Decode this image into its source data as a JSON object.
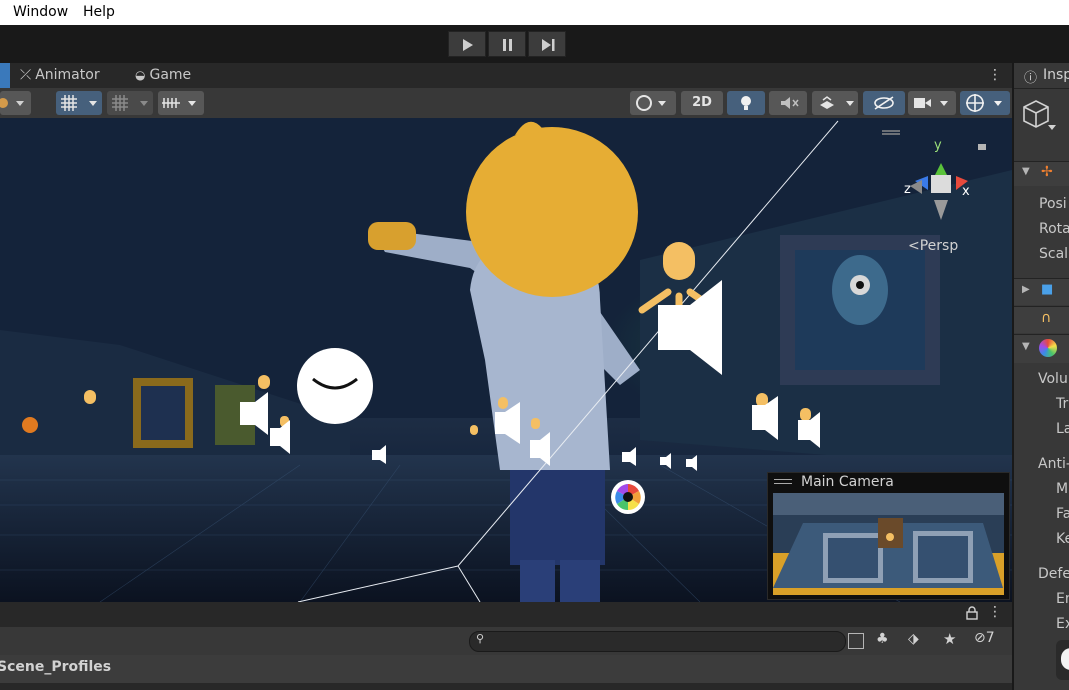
{
  "menu": {
    "window": "Window",
    "help": "Help"
  },
  "tabs": {
    "animator": "Animator",
    "game": "Game",
    "inspector": "Insp"
  },
  "scene": {
    "persp": "Persp",
    "gizmo_y": "y",
    "gizmo_x": "x",
    "gizmo_z": "z",
    "btn_2d": "2D"
  },
  "camera_preview": {
    "title": "Main Camera"
  },
  "bottom": {
    "search_placeholder": "",
    "hidden_count": "7",
    "scene_profiles": "Scene_Profiles"
  },
  "inspector": {
    "transform_rows": [
      "Posi",
      "Rota",
      "Scal"
    ],
    "sections": [
      {
        "label": "Volu",
        "rows": [
          "Tr",
          "La"
        ]
      },
      {
        "label": "Anti-",
        "rows": [
          "M",
          "Fa",
          "Ke"
        ]
      },
      {
        "label": "Defe",
        "rows": [
          "En",
          "Ex"
        ]
      }
    ]
  },
  "colors": {
    "accent": "#46607c",
    "gizmo_icon": "#f4bf63",
    "background": "#191919"
  }
}
